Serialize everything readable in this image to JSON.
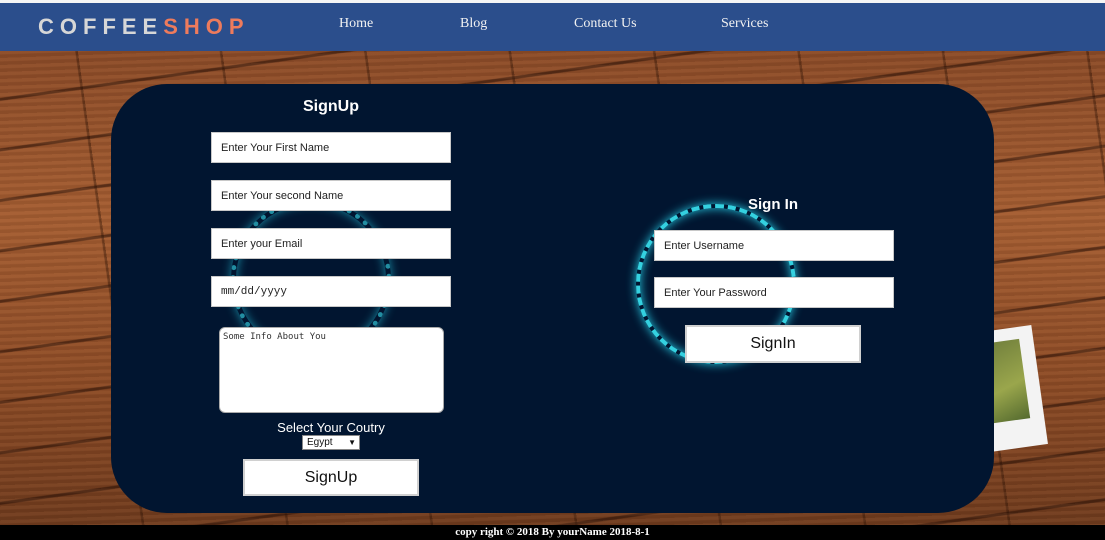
{
  "brand": {
    "logo_main": "Coffee",
    "logo_accent": "Shop"
  },
  "nav": {
    "home": "Home",
    "blog": "Blog",
    "contact": "Contact Us",
    "services": "Services"
  },
  "signup": {
    "title": "SignUp",
    "first_name_placeholder": "Enter Your First Name",
    "second_name_placeholder": "Enter Your second Name",
    "email_placeholder": "Enter your Email",
    "date_placeholder": "mm/dd/yyyy",
    "info_placeholder": "Some Info About You",
    "country_label": "Select Your Coutry",
    "country_selected": "Egypt",
    "button_label": "SignUp"
  },
  "signin": {
    "title": "Sign In",
    "username_placeholder": "Enter Username",
    "password_placeholder": "Enter Your Password",
    "button_label": "SignIn"
  },
  "footer": {
    "text": "copy right © 2018 By yourName 2018-8-1"
  },
  "colors": {
    "navbar": "#2b4e8c",
    "card": "#011530",
    "logo_accent": "#ee7b5c",
    "glow": "#3ef2ff"
  }
}
